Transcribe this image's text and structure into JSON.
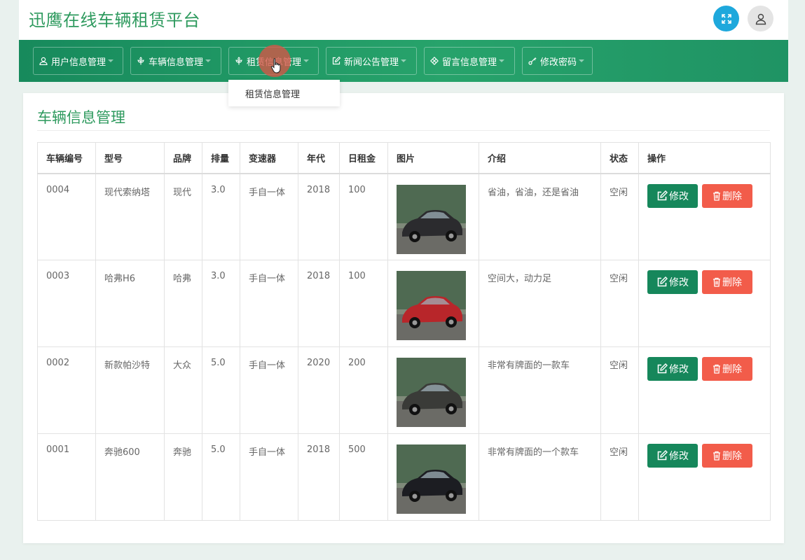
{
  "site_title": "迅鹰在线车辆租赁平台",
  "nav": [
    {
      "label": "用户信息管理",
      "icon": "user-icon"
    },
    {
      "label": "车辆信息管理",
      "icon": "flower-icon"
    },
    {
      "label": "租赁信息管理",
      "icon": "flower-icon"
    },
    {
      "label": "新闻公告管理",
      "icon": "edit-icon"
    },
    {
      "label": "留言信息管理",
      "icon": "grid-icon"
    },
    {
      "label": "修改密码",
      "icon": "key-icon"
    }
  ],
  "dropdown": {
    "item": "租赁信息管理"
  },
  "panel": {
    "title": "车辆信息管理"
  },
  "table": {
    "headers": [
      "车辆编号",
      "型号",
      "品牌",
      "排量",
      "变速器",
      "年代",
      "日租金",
      "图片",
      "介绍",
      "状态",
      "操作"
    ],
    "rows": [
      {
        "id": "0004",
        "model": "现代索纳塔",
        "brand": "现代",
        "displacement": "3.0",
        "gearbox": "手自一体",
        "year": "2018",
        "rent": "100",
        "intro": "省油，省油，还是省油",
        "status": "空闲",
        "car_color": "#2b2b2e"
      },
      {
        "id": "0003",
        "model": "哈弗H6",
        "brand": "哈弗",
        "displacement": "3.0",
        "gearbox": "手自一体",
        "year": "2018",
        "rent": "100",
        "intro": "空间大，动力足",
        "status": "空闲",
        "car_color": "#b8262a"
      },
      {
        "id": "0002",
        "model": "新款帕沙特",
        "brand": "大众",
        "displacement": "5.0",
        "gearbox": "手自一体",
        "year": "2020",
        "rent": "200",
        "intro": "非常有牌面的一款车",
        "status": "空闲",
        "car_color": "#3a3b38"
      },
      {
        "id": "0001",
        "model": "奔驰600",
        "brand": "奔驰",
        "displacement": "5.0",
        "gearbox": "手自一体",
        "year": "2018",
        "rent": "500",
        "intro": "非常有牌面的一个款车",
        "status": "空闲",
        "car_color": "#1c1d22"
      }
    ],
    "edit_label": "修改",
    "delete_label": "删除"
  },
  "colors": {
    "accent": "#2e9a5e",
    "nav_bg": "#178a5c",
    "edit": "#16875b",
    "delete": "#f25c4a",
    "fullscreen": "#1ea8dc"
  }
}
